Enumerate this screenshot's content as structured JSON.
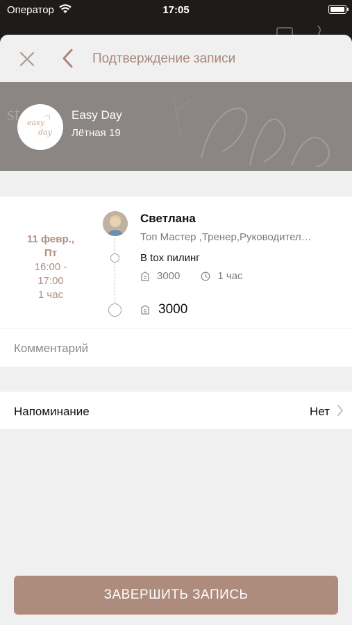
{
  "status_bar": {
    "carrier": "Оператор",
    "time": "17:05"
  },
  "nav": {
    "title": "Подтверждение записи"
  },
  "salon": {
    "name": "Easy Day",
    "address": "Лётная 19",
    "logo_text": "easy day",
    "banner_text": "by S.Tr"
  },
  "booking": {
    "date": "11 февр.,",
    "weekday": "Пт",
    "time_range_start": "16:00 -",
    "time_range_end": "17:00",
    "duration": "1 час",
    "master_name": "Светлана",
    "master_role": "Топ Мастер ,Тренер,Руководител…",
    "service_name": "B tox пилинг",
    "service_price": "3000",
    "service_duration": "1 час",
    "total": "3000"
  },
  "comment": {
    "placeholder": "Комментарий",
    "value": ""
  },
  "reminder": {
    "label": "Напоминание",
    "value": "Нет"
  },
  "actions": {
    "finish_label": "ЗАВЕРШИТЬ ЗАПИСЬ"
  },
  "colors": {
    "accent": "#ad8b7d",
    "title": "#a88779",
    "date": "#b08f80"
  }
}
